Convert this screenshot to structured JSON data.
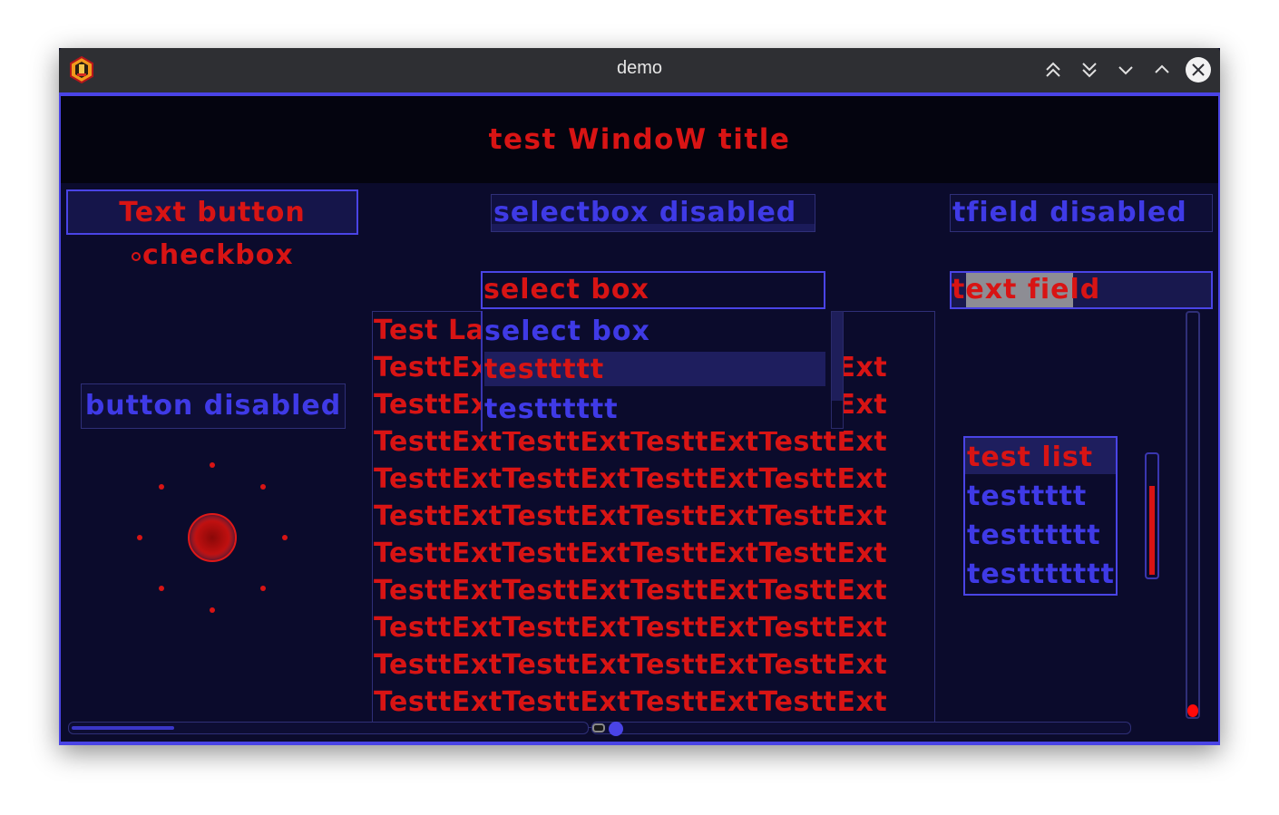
{
  "window": {
    "title": "demo"
  },
  "header": {
    "title": "test WindoW title"
  },
  "buttons": {
    "text_button": "Text button",
    "button_disabled": "button disabled"
  },
  "checkbox": {
    "label": "checkbox"
  },
  "selectbox": {
    "disabled_label": "selectbox disabled",
    "value": "select box",
    "options": [
      "select box",
      "testtttt",
      "testttttt"
    ]
  },
  "textfields": {
    "disabled_label": "tfield disabled",
    "value": "text field"
  },
  "label_area": {
    "lines": [
      "Test Label",
      "TesttExtTesttExtTesttExtTesttExt",
      "TesttExtTesttExtTesttExtTesttExt",
      "TesttExtTesttExtTesttExtTesttExt",
      "TesttExtTesttExtTesttExtTesttExt",
      "TesttExtTesttExtTesttExtTesttExt",
      "TesttExtTesttExtTesttExtTesttExt",
      "TesttExtTesttExtTesttExtTesttExt",
      "TesttExtTesttExtTesttExtTesttExt",
      "TesttExtTesttExtTesttExtTesttExt",
      "TesttExtTesttExtTesttExtTesttExt"
    ]
  },
  "test_list": {
    "items": [
      "test list",
      "testtttt",
      "testttttt",
      "testtttttt"
    ]
  },
  "progress": {
    "horizontal_fraction": 0.2,
    "vertical_fraction": 0.75
  },
  "colors": {
    "accent": "#4a44e6",
    "text_red": "#d81414",
    "text_blue": "#3f3ae6",
    "background": "#0b0b2c"
  },
  "icons": [
    "app-logo-icon",
    "keep-above-icon",
    "keep-below-icon",
    "minimize-icon",
    "maximize-icon",
    "close-icon",
    "spinner-icon"
  ]
}
